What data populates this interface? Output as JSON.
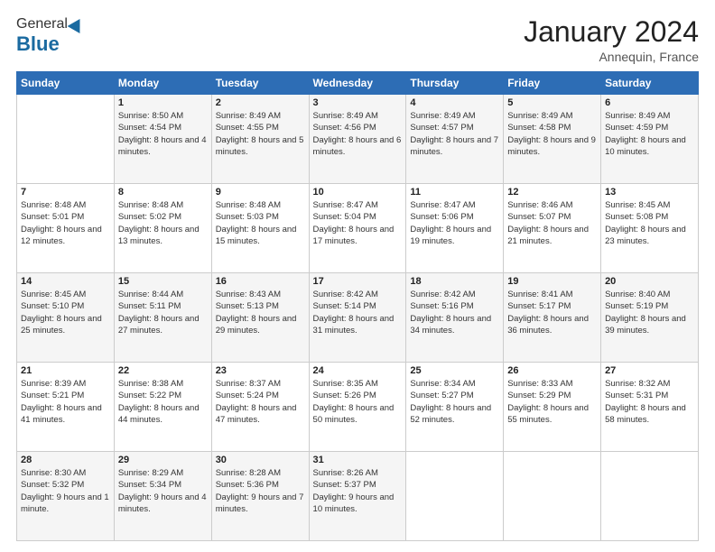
{
  "header": {
    "logo_general": "General",
    "logo_blue": "Blue",
    "month_title": "January 2024",
    "location": "Annequin, France"
  },
  "days_of_week": [
    "Sunday",
    "Monday",
    "Tuesday",
    "Wednesday",
    "Thursday",
    "Friday",
    "Saturday"
  ],
  "weeks": [
    [
      {
        "num": "",
        "sunrise": "",
        "sunset": "",
        "daylight": "",
        "empty": true
      },
      {
        "num": "1",
        "sunrise": "Sunrise: 8:50 AM",
        "sunset": "Sunset: 4:54 PM",
        "daylight": "Daylight: 8 hours and 4 minutes."
      },
      {
        "num": "2",
        "sunrise": "Sunrise: 8:49 AM",
        "sunset": "Sunset: 4:55 PM",
        "daylight": "Daylight: 8 hours and 5 minutes."
      },
      {
        "num": "3",
        "sunrise": "Sunrise: 8:49 AM",
        "sunset": "Sunset: 4:56 PM",
        "daylight": "Daylight: 8 hours and 6 minutes."
      },
      {
        "num": "4",
        "sunrise": "Sunrise: 8:49 AM",
        "sunset": "Sunset: 4:57 PM",
        "daylight": "Daylight: 8 hours and 7 minutes."
      },
      {
        "num": "5",
        "sunrise": "Sunrise: 8:49 AM",
        "sunset": "Sunset: 4:58 PM",
        "daylight": "Daylight: 8 hours and 9 minutes."
      },
      {
        "num": "6",
        "sunrise": "Sunrise: 8:49 AM",
        "sunset": "Sunset: 4:59 PM",
        "daylight": "Daylight: 8 hours and 10 minutes."
      }
    ],
    [
      {
        "num": "7",
        "sunrise": "Sunrise: 8:48 AM",
        "sunset": "Sunset: 5:01 PM",
        "daylight": "Daylight: 8 hours and 12 minutes."
      },
      {
        "num": "8",
        "sunrise": "Sunrise: 8:48 AM",
        "sunset": "Sunset: 5:02 PM",
        "daylight": "Daylight: 8 hours and 13 minutes."
      },
      {
        "num": "9",
        "sunrise": "Sunrise: 8:48 AM",
        "sunset": "Sunset: 5:03 PM",
        "daylight": "Daylight: 8 hours and 15 minutes."
      },
      {
        "num": "10",
        "sunrise": "Sunrise: 8:47 AM",
        "sunset": "Sunset: 5:04 PM",
        "daylight": "Daylight: 8 hours and 17 minutes."
      },
      {
        "num": "11",
        "sunrise": "Sunrise: 8:47 AM",
        "sunset": "Sunset: 5:06 PM",
        "daylight": "Daylight: 8 hours and 19 minutes."
      },
      {
        "num": "12",
        "sunrise": "Sunrise: 8:46 AM",
        "sunset": "Sunset: 5:07 PM",
        "daylight": "Daylight: 8 hours and 21 minutes."
      },
      {
        "num": "13",
        "sunrise": "Sunrise: 8:45 AM",
        "sunset": "Sunset: 5:08 PM",
        "daylight": "Daylight: 8 hours and 23 minutes."
      }
    ],
    [
      {
        "num": "14",
        "sunrise": "Sunrise: 8:45 AM",
        "sunset": "Sunset: 5:10 PM",
        "daylight": "Daylight: 8 hours and 25 minutes."
      },
      {
        "num": "15",
        "sunrise": "Sunrise: 8:44 AM",
        "sunset": "Sunset: 5:11 PM",
        "daylight": "Daylight: 8 hours and 27 minutes."
      },
      {
        "num": "16",
        "sunrise": "Sunrise: 8:43 AM",
        "sunset": "Sunset: 5:13 PM",
        "daylight": "Daylight: 8 hours and 29 minutes."
      },
      {
        "num": "17",
        "sunrise": "Sunrise: 8:42 AM",
        "sunset": "Sunset: 5:14 PM",
        "daylight": "Daylight: 8 hours and 31 minutes."
      },
      {
        "num": "18",
        "sunrise": "Sunrise: 8:42 AM",
        "sunset": "Sunset: 5:16 PM",
        "daylight": "Daylight: 8 hours and 34 minutes."
      },
      {
        "num": "19",
        "sunrise": "Sunrise: 8:41 AM",
        "sunset": "Sunset: 5:17 PM",
        "daylight": "Daylight: 8 hours and 36 minutes."
      },
      {
        "num": "20",
        "sunrise": "Sunrise: 8:40 AM",
        "sunset": "Sunset: 5:19 PM",
        "daylight": "Daylight: 8 hours and 39 minutes."
      }
    ],
    [
      {
        "num": "21",
        "sunrise": "Sunrise: 8:39 AM",
        "sunset": "Sunset: 5:21 PM",
        "daylight": "Daylight: 8 hours and 41 minutes."
      },
      {
        "num": "22",
        "sunrise": "Sunrise: 8:38 AM",
        "sunset": "Sunset: 5:22 PM",
        "daylight": "Daylight: 8 hours and 44 minutes."
      },
      {
        "num": "23",
        "sunrise": "Sunrise: 8:37 AM",
        "sunset": "Sunset: 5:24 PM",
        "daylight": "Daylight: 8 hours and 47 minutes."
      },
      {
        "num": "24",
        "sunrise": "Sunrise: 8:35 AM",
        "sunset": "Sunset: 5:26 PM",
        "daylight": "Daylight: 8 hours and 50 minutes."
      },
      {
        "num": "25",
        "sunrise": "Sunrise: 8:34 AM",
        "sunset": "Sunset: 5:27 PM",
        "daylight": "Daylight: 8 hours and 52 minutes."
      },
      {
        "num": "26",
        "sunrise": "Sunrise: 8:33 AM",
        "sunset": "Sunset: 5:29 PM",
        "daylight": "Daylight: 8 hours and 55 minutes."
      },
      {
        "num": "27",
        "sunrise": "Sunrise: 8:32 AM",
        "sunset": "Sunset: 5:31 PM",
        "daylight": "Daylight: 8 hours and 58 minutes."
      }
    ],
    [
      {
        "num": "28",
        "sunrise": "Sunrise: 8:30 AM",
        "sunset": "Sunset: 5:32 PM",
        "daylight": "Daylight: 9 hours and 1 minute."
      },
      {
        "num": "29",
        "sunrise": "Sunrise: 8:29 AM",
        "sunset": "Sunset: 5:34 PM",
        "daylight": "Daylight: 9 hours and 4 minutes."
      },
      {
        "num": "30",
        "sunrise": "Sunrise: 8:28 AM",
        "sunset": "Sunset: 5:36 PM",
        "daylight": "Daylight: 9 hours and 7 minutes."
      },
      {
        "num": "31",
        "sunrise": "Sunrise: 8:26 AM",
        "sunset": "Sunset: 5:37 PM",
        "daylight": "Daylight: 9 hours and 10 minutes."
      },
      {
        "num": "",
        "sunrise": "",
        "sunset": "",
        "daylight": "",
        "empty": true
      },
      {
        "num": "",
        "sunrise": "",
        "sunset": "",
        "daylight": "",
        "empty": true
      },
      {
        "num": "",
        "sunrise": "",
        "sunset": "",
        "daylight": "",
        "empty": true
      }
    ]
  ]
}
